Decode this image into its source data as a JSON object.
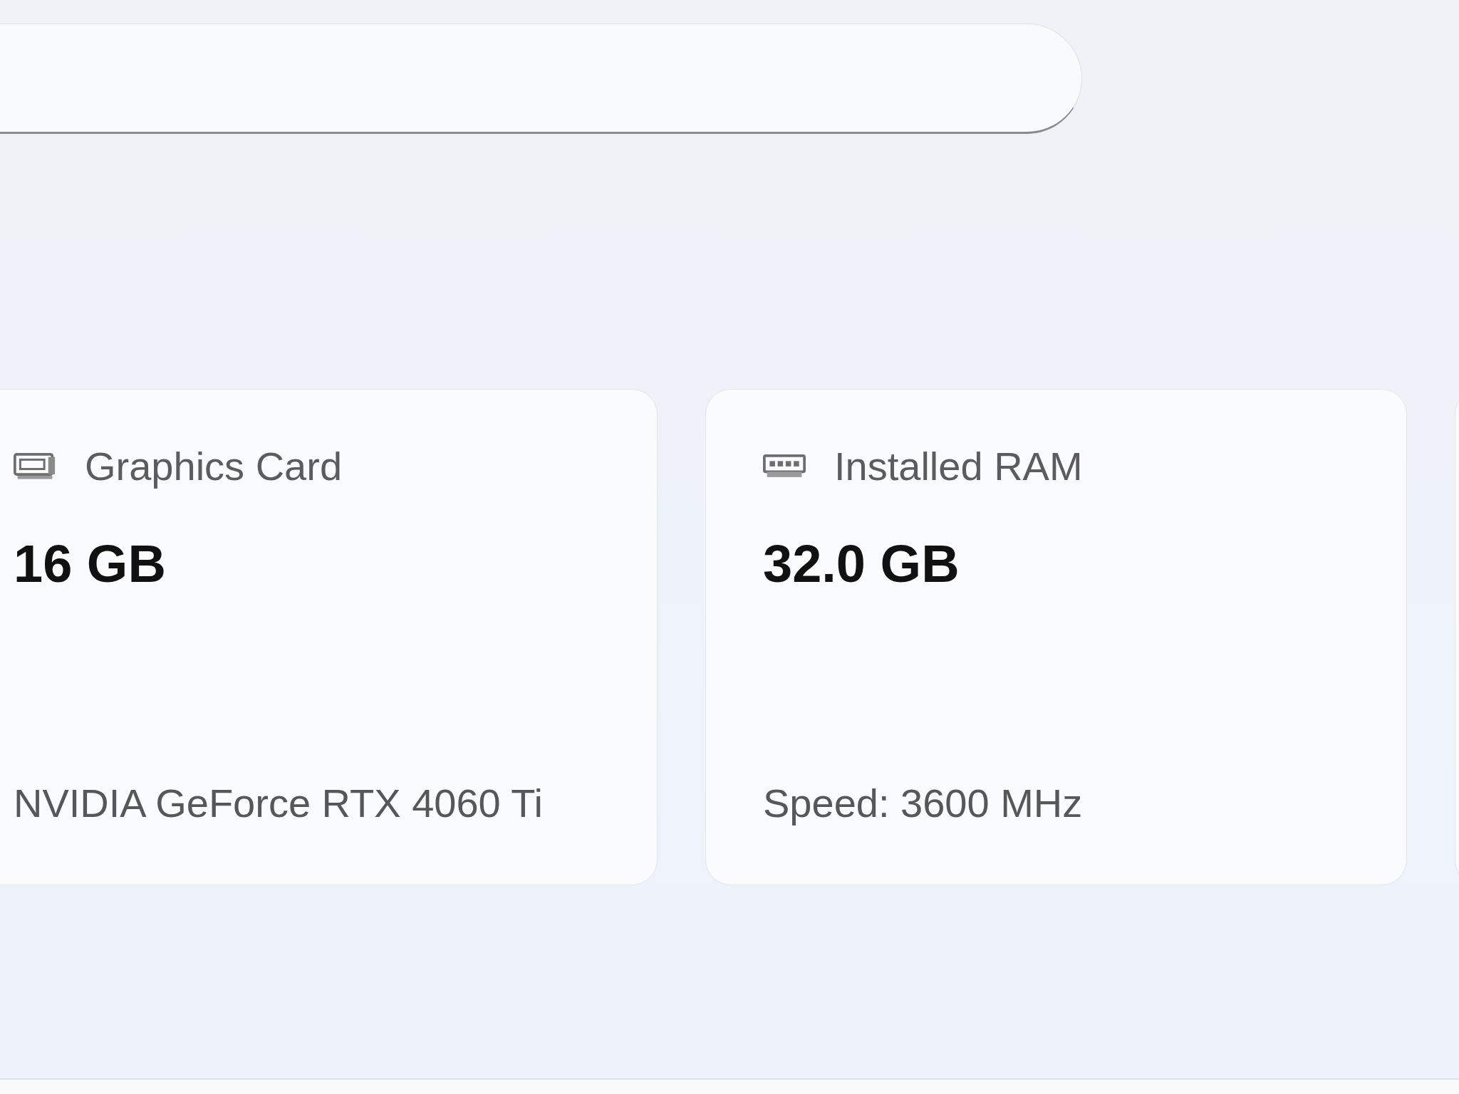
{
  "cards": [
    {
      "kind": "gpu",
      "label": "Graphics Card",
      "value": "16 GB",
      "detail": "NVIDIA GeForce RTX 4060 Ti"
    },
    {
      "kind": "ram",
      "label": "Installed RAM",
      "value": "32.0 GB",
      "detail": "Speed: 3600 MHz"
    }
  ]
}
